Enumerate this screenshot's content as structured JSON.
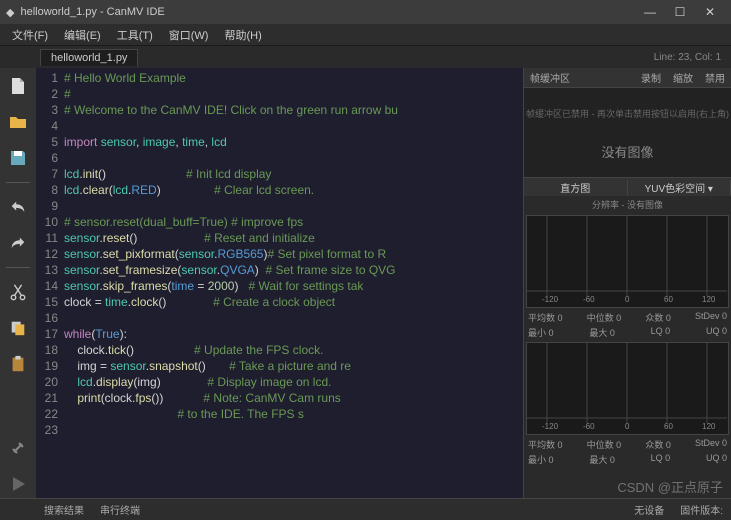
{
  "window": {
    "title": "helloworld_1.py - CanMV IDE"
  },
  "menu": {
    "file": "文件(F)",
    "edit": "编辑(E)",
    "tools": "工具(T)",
    "window": "窗口(W)",
    "help": "帮助(H)"
  },
  "tab": {
    "name": "helloworld_1.py"
  },
  "lineinfo": "Line: 23, Col: 1",
  "code": [
    {
      "n": 1,
      "seg": [
        [
          "c-comment",
          "# Hello World Example"
        ]
      ]
    },
    {
      "n": 2,
      "seg": [
        [
          "c-comment",
          "#"
        ]
      ]
    },
    {
      "n": 3,
      "seg": [
        [
          "c-comment",
          "# Welcome to the CanMV IDE! Click on the green run arrow bu"
        ]
      ]
    },
    {
      "n": 4,
      "seg": [
        [
          "",
          ""
        ]
      ]
    },
    {
      "n": 5,
      "seg": [
        [
          "c-kw",
          "import"
        ],
        [
          "",
          " "
        ],
        [
          "c-mod",
          "sensor"
        ],
        [
          "c-op",
          ", "
        ],
        [
          "c-mod",
          "image"
        ],
        [
          "c-op",
          ", "
        ],
        [
          "c-mod",
          "time"
        ],
        [
          "c-op",
          ", "
        ],
        [
          "c-mod",
          "lcd"
        ]
      ]
    },
    {
      "n": 6,
      "seg": [
        [
          "",
          ""
        ]
      ]
    },
    {
      "n": 7,
      "seg": [
        [
          "c-mod",
          "lcd"
        ],
        [
          "c-op",
          "."
        ],
        [
          "c-func",
          "init"
        ],
        [
          "c-op",
          "()"
        ],
        [
          "",
          "                        "
        ],
        [
          "c-comment",
          "# Init lcd display"
        ]
      ]
    },
    {
      "n": 8,
      "seg": [
        [
          "c-mod",
          "lcd"
        ],
        [
          "c-op",
          "."
        ],
        [
          "c-func",
          "clear"
        ],
        [
          "c-op",
          "("
        ],
        [
          "c-mod",
          "lcd"
        ],
        [
          "c-op",
          "."
        ],
        [
          "c-builtin",
          "RED"
        ],
        [
          "c-op",
          ")"
        ],
        [
          "",
          "                "
        ],
        [
          "c-comment",
          "# Clear lcd screen."
        ]
      ]
    },
    {
      "n": 9,
      "seg": [
        [
          "",
          ""
        ]
      ]
    },
    {
      "n": 10,
      "seg": [
        [
          "c-comment",
          "# sensor.reset(dual_buff=True) # improve fps"
        ]
      ]
    },
    {
      "n": 11,
      "seg": [
        [
          "c-mod",
          "sensor"
        ],
        [
          "c-op",
          "."
        ],
        [
          "c-func",
          "reset"
        ],
        [
          "c-op",
          "()"
        ],
        [
          "",
          "                    "
        ],
        [
          "c-comment",
          "# Reset and initialize "
        ]
      ]
    },
    {
      "n": 12,
      "seg": [
        [
          "c-mod",
          "sensor"
        ],
        [
          "c-op",
          "."
        ],
        [
          "c-func",
          "set_pixformat"
        ],
        [
          "c-op",
          "("
        ],
        [
          "c-mod",
          "sensor"
        ],
        [
          "c-op",
          "."
        ],
        [
          "c-builtin",
          "RGB565"
        ],
        [
          "c-op",
          ")"
        ],
        [
          "",
          ""
        ],
        [
          "c-comment",
          "# Set pixel format to R"
        ]
      ]
    },
    {
      "n": 13,
      "seg": [
        [
          "c-mod",
          "sensor"
        ],
        [
          "c-op",
          "."
        ],
        [
          "c-func",
          "set_framesize"
        ],
        [
          "c-op",
          "("
        ],
        [
          "c-mod",
          "sensor"
        ],
        [
          "c-op",
          "."
        ],
        [
          "c-builtin",
          "QVGA"
        ],
        [
          "c-op",
          ")"
        ],
        [
          "",
          "  "
        ],
        [
          "c-comment",
          "# Set frame size to QVG"
        ]
      ]
    },
    {
      "n": 14,
      "seg": [
        [
          "c-mod",
          "sensor"
        ],
        [
          "c-op",
          "."
        ],
        [
          "c-func",
          "skip_frames"
        ],
        [
          "c-op",
          "("
        ],
        [
          "c-builtin",
          "time"
        ],
        [
          "c-op",
          " = "
        ],
        [
          "c-num",
          "2000"
        ],
        [
          "c-op",
          ")"
        ],
        [
          "",
          "   "
        ],
        [
          "c-comment",
          "# Wait for settings tak"
        ]
      ]
    },
    {
      "n": 15,
      "seg": [
        [
          "",
          "clock "
        ],
        [
          "c-op",
          "= "
        ],
        [
          "c-mod",
          "time"
        ],
        [
          "c-op",
          "."
        ],
        [
          "c-func",
          "clock"
        ],
        [
          "c-op",
          "()"
        ],
        [
          "",
          "              "
        ],
        [
          "c-comment",
          "# Create a clock object"
        ]
      ]
    },
    {
      "n": 16,
      "seg": [
        [
          "",
          ""
        ]
      ]
    },
    {
      "n": 17,
      "seg": [
        [
          "c-kw",
          "while"
        ],
        [
          "c-op",
          "("
        ],
        [
          "c-builtin",
          "True"
        ],
        [
          "c-op",
          "):"
        ]
      ]
    },
    {
      "n": 18,
      "seg": [
        [
          "",
          "    clock"
        ],
        [
          "c-op",
          "."
        ],
        [
          "c-func",
          "tick"
        ],
        [
          "c-op",
          "()"
        ],
        [
          "",
          "                  "
        ],
        [
          "c-comment",
          "# Update the FPS clock."
        ]
      ]
    },
    {
      "n": 19,
      "seg": [
        [
          "",
          "    img "
        ],
        [
          "c-op",
          "= "
        ],
        [
          "c-mod",
          "sensor"
        ],
        [
          "c-op",
          "."
        ],
        [
          "c-func",
          "snapshot"
        ],
        [
          "c-op",
          "()"
        ],
        [
          "",
          "       "
        ],
        [
          "c-comment",
          "# Take a picture and re"
        ]
      ]
    },
    {
      "n": 20,
      "seg": [
        [
          "",
          "    "
        ],
        [
          "c-mod",
          "lcd"
        ],
        [
          "c-op",
          "."
        ],
        [
          "c-func",
          "display"
        ],
        [
          "c-op",
          "(img)"
        ],
        [
          "",
          "              "
        ],
        [
          "c-comment",
          "# Display image on lcd."
        ]
      ]
    },
    {
      "n": 21,
      "seg": [
        [
          "",
          "    "
        ],
        [
          "c-func",
          "print"
        ],
        [
          "c-op",
          "(clock."
        ],
        [
          "c-func",
          "fps"
        ],
        [
          "c-op",
          "())"
        ],
        [
          "",
          "            "
        ],
        [
          "c-comment",
          "# Note: CanMV Cam runs "
        ]
      ]
    },
    {
      "n": 22,
      "seg": [
        [
          "",
          "                                  "
        ],
        [
          "c-comment",
          "# to the IDE. The FPS s"
        ]
      ]
    },
    {
      "n": 23,
      "seg": [
        [
          "",
          ""
        ]
      ]
    }
  ],
  "right": {
    "tabs": {
      "fb": "帧缓冲区",
      "rec": "录制",
      "zoom": "缩放",
      "disable": "禁用"
    },
    "fbhint": "帧缓冲区已禁用 - 再次单击禁用按钮以启用(右上角)",
    "noimage": "没有图像",
    "hist": {
      "title": "直方图",
      "colorspace": "YUV色彩空间",
      "res": "分辨率 - 没有图像"
    },
    "stats": {
      "mean": "平均数 0",
      "median": "中位数 0",
      "mode": "众数   0",
      "stdev": "StDev  0",
      "min": "最小   0",
      "max": "最大   0",
      "lq": "LQ     0",
      "uq": "UQ     0"
    },
    "axis": {
      "t0": "-120",
      "t1": "-60",
      "t2": "0",
      "t3": "60",
      "t4": "120"
    }
  },
  "bottom": {
    "search": "搜索结果",
    "term": "串行终端",
    "nodev": "无设备",
    "noboard": "固件版本:",
    "watermark": "CSDN @正点原子"
  }
}
